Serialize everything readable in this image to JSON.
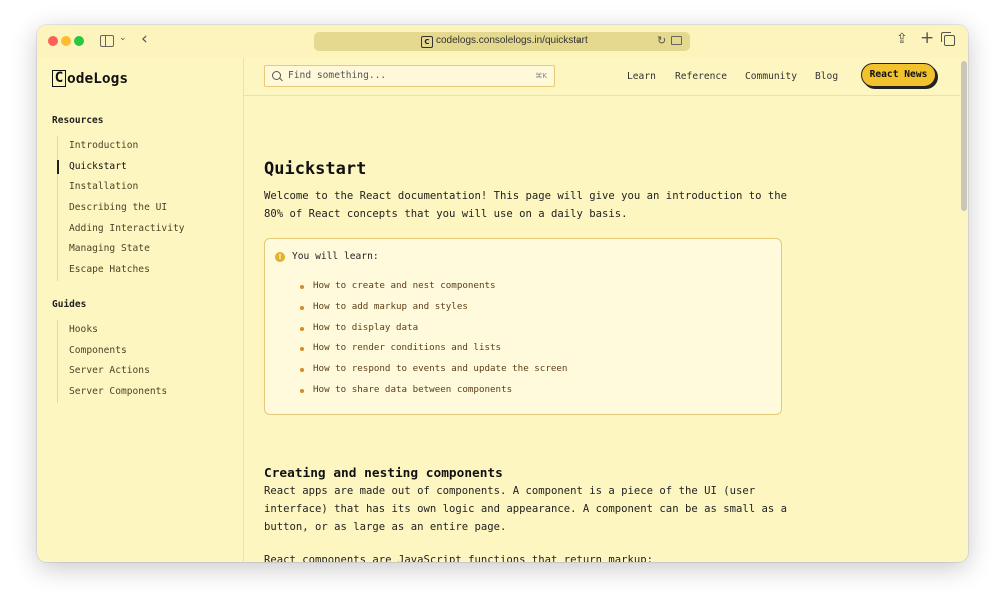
{
  "browser": {
    "url": "codelogs.consolelogs.in/quickstart"
  },
  "header": {
    "logo_letter": "C",
    "logo_rest": "odeLogs",
    "search_placeholder": "Find something...",
    "search_shortcut": "⌘K",
    "nav": [
      "Learn",
      "Reference",
      "Community",
      "Blog"
    ],
    "cta": "React News"
  },
  "sidebar": {
    "resources_title": "Resources",
    "resources": [
      "Introduction",
      "Quickstart",
      "Installation",
      "Describing the UI",
      "Adding Interactivity",
      "Managing State",
      "Escape Hatches"
    ],
    "active_item": "Quickstart",
    "guides_title": "Guides",
    "guides": [
      "Hooks",
      "Components",
      "Server Actions",
      "Server Components"
    ]
  },
  "main": {
    "title": "Quickstart",
    "intro_line1": "Welcome to the React documentation! This page will give you an introduction to the",
    "intro_line2": "80% of React concepts that you will use on a daily basis.",
    "callout": {
      "title": "You will learn:",
      "items": [
        "How to create and nest components",
        "How to add markup and styles",
        "How to display data",
        "How to render conditions and lists",
        "How to respond to events and update the screen",
        "How to share data between components"
      ]
    },
    "section_title": "Creating and nesting components",
    "section_line1": "React apps are made out of components. A component is a piece of the UI (user",
    "section_line2": "interface) that has its own logic and appearance. A component can be as small as a",
    "section_line3": "button, or as large as an entire page.",
    "section_para2": "React components are JavaScript functions that return markup:"
  }
}
